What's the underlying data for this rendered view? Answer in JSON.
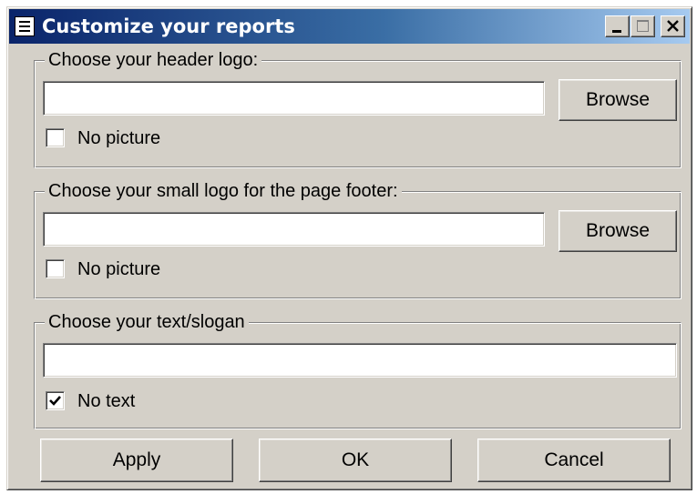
{
  "window": {
    "title": "Customize your reports"
  },
  "header_logo": {
    "legend": "Choose your header logo:",
    "path_value": "",
    "browse_label": "Browse",
    "no_picture_label": "No picture",
    "no_picture_checked": false
  },
  "footer_logo": {
    "legend": "Choose your small logo for the page footer:",
    "path_value": "",
    "browse_label": "Browse",
    "no_picture_label": "No picture",
    "no_picture_checked": false
  },
  "slogan": {
    "legend": "Choose your text/slogan",
    "text_value": "",
    "no_text_label": "No text",
    "no_text_checked": true
  },
  "actions": {
    "apply_label": "Apply",
    "ok_label": "OK",
    "cancel_label": "Cancel"
  },
  "colors": {
    "titlebar_start": "#0a246a",
    "titlebar_end": "#a6caf0",
    "face": "#d4d0c8"
  },
  "icons": {
    "app": "report-icon",
    "minimize": "minimize-icon",
    "maximize": "maximize-icon",
    "close": "close-icon",
    "check": "checkmark-icon"
  }
}
